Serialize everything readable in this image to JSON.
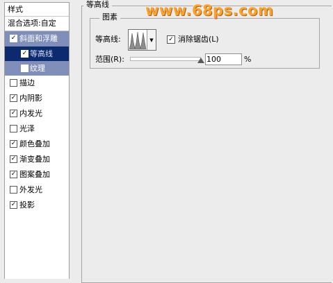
{
  "style_panel": {
    "header": "样式",
    "blending_options": "混合选项:自定",
    "items": [
      {
        "label": "斜面和浮雕",
        "checked": true
      },
      {
        "label": "等高线",
        "checked": true
      },
      {
        "label": "纹理",
        "checked": false
      },
      {
        "label": "描边",
        "checked": false
      },
      {
        "label": "内阴影",
        "checked": true
      },
      {
        "label": "内发光",
        "checked": true
      },
      {
        "label": "光泽",
        "checked": false
      },
      {
        "label": "颜色叠加",
        "checked": true
      },
      {
        "label": "渐变叠加",
        "checked": true
      },
      {
        "label": "图案叠加",
        "checked": true
      },
      {
        "label": "外发光",
        "checked": false
      },
      {
        "label": "投影",
        "checked": true
      }
    ]
  },
  "contour_section": {
    "title": "等高线",
    "elements_title": "图素",
    "contour_label": "等高线:",
    "anti_alias_label": "消除锯齿(L)",
    "anti_alias_checked": true,
    "range_label": "范围(R):",
    "range_value": "100",
    "range_fraction": 1.0,
    "range_unit": "%"
  },
  "watermark": "www.68ps.com",
  "icons": {
    "check": "check-icon",
    "dropdown": "triangle-down-icon",
    "contour_preview": "contour-curve-icon"
  },
  "colors": {
    "selected_row": "#0c2a6e",
    "highlight_rows": "#7f8fba",
    "watermark": "#f6a334"
  }
}
